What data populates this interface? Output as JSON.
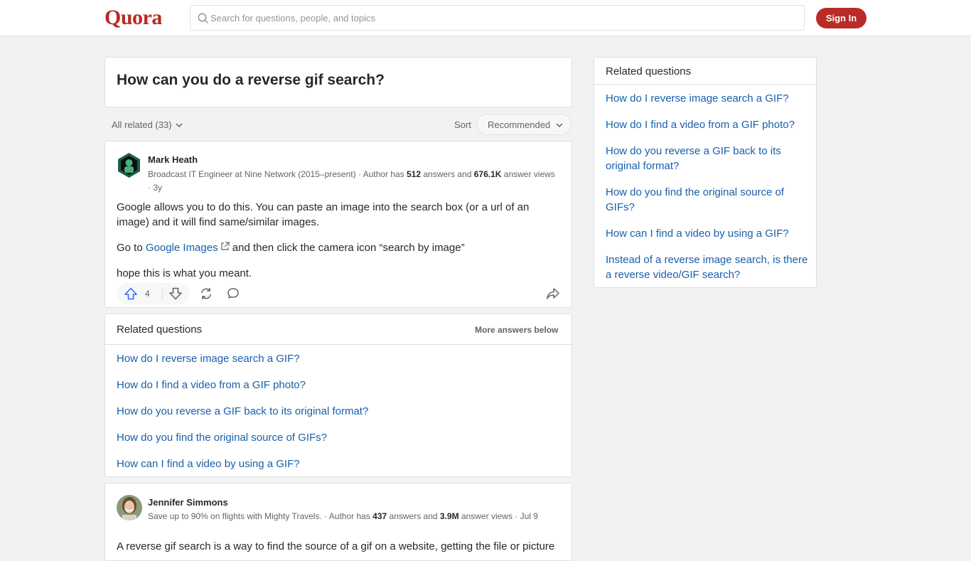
{
  "header": {
    "logo": "Quora",
    "search_placeholder": "Search for questions, people, and topics",
    "signin_label": "Sign In"
  },
  "question": {
    "title": "How can you do a reverse gif search?"
  },
  "sortbar": {
    "all_related": "All related (33)",
    "sort_label": "Sort",
    "sort_value": "Recommended"
  },
  "answer1": {
    "author": "Mark Heath",
    "cred_text": "Broadcast IT Engineer at Nine Network (2015–present) · Author has ",
    "answers_count": "512",
    "mid_text": " answers and ",
    "views_count": "676.1K",
    "tail_text": " answer views · 3y",
    "para1": "Google allows you to do this. You can paste an image into the search box (or a url of an image) and it will find same/similar images.",
    "para2_pre": "Go to ",
    "para2_link": "Google Images",
    "para2_post": " and then click the camera icon “search by image”",
    "para3": "hope this is what you meant.",
    "upvotes": "4"
  },
  "related_inline": {
    "title": "Related questions",
    "more": "More answers below",
    "items": [
      "How do I reverse image search a GIF?",
      "How do I find a video from a GIF photo?",
      "How do you reverse a GIF back to its original format?",
      "How do you find the original source of GIFs?",
      "How can I find a video by using a GIF?"
    ]
  },
  "answer2": {
    "author": "Jennifer Simmons",
    "cred_text": "Save up to 90% on flights with Mighty Travels. · Author has ",
    "answers_count": "437",
    "mid_text": " answers and ",
    "views_count": "3.9M",
    "tail_text": " answer views · Jul 9",
    "snippet": "A reverse gif search is a way to find the source of a gif on a website, getting the file or picture"
  },
  "sidebar": {
    "title": "Related questions",
    "items": [
      "How do I reverse image search a GIF?",
      "How do I find a video from a GIF photo?",
      "How do you reverse a GIF back to its original format?",
      "How do you find the original source of GIFs?",
      "How can I find a video by using a GIF?",
      "Instead of a reverse image search, is there a reverse video/GIF search?"
    ]
  },
  "colors": {
    "brand": "#b92b27",
    "link": "#195faa",
    "background": "#f1f2f2"
  }
}
